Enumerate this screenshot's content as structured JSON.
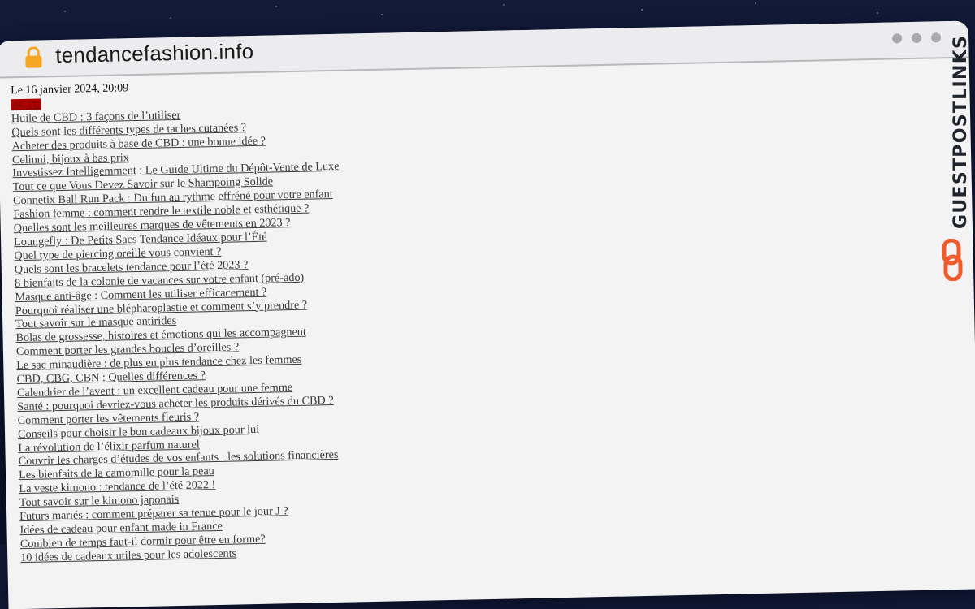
{
  "browser": {
    "url": "tendancefashion.info",
    "window_controls": [
      "dot",
      "dot",
      "dot"
    ]
  },
  "brand": {
    "name": "GUESTPOSTLINKS",
    "logo_icon": "chain-link-icon",
    "logo_color": "#ef5b2a"
  },
  "page": {
    "date": "Le 16 janvier 2024, 20:09",
    "category_badge": "ACTU",
    "badge_color": "#b00000",
    "articles": [
      "Huile de CBD : 3 façons de l’utiliser",
      "Quels sont les différents types de taches cutanées ?",
      "Acheter des produits à base de CBD : une bonne idée ?",
      "Celinni, bijoux à bas prix",
      "Investissez Intelligemment : Le Guide Ultime du Dépôt-Vente de Luxe",
      "Tout ce que Vous Devez Savoir sur le Shampoing Solide",
      "Connetix Ball Run Pack : Du fun au rythme effréné pour votre enfant",
      "Fashion femme : comment rendre le textile noble et esthétique ?",
      "Quelles sont les meilleures marques de vêtements en 2023 ?",
      "Loungefly : De Petits Sacs Tendance Idéaux pour l’Été",
      "Quel type de piercing oreille vous convient ?",
      "Quels sont les bracelets tendance pour l’été 2023 ?",
      "8 bienfaits de la colonie de vacances sur votre enfant (pré-ado)",
      "Masque anti-âge : Comment les utiliser efficacement ?",
      "Pourquoi réaliser une blépharoplastie et comment s’y prendre ?",
      "Tout savoir sur le masque antirides",
      "Bolas de grossesse, histoires et émotions qui les accompagnent",
      "Comment porter les grandes boucles d’oreilles ?",
      "Le sac minaudière : de plus en plus tendance chez les femmes",
      "CBD, CBG, CBN : Quelles différences ?",
      "Calendrier de l’avent : un excellent cadeau pour une femme",
      "Santé : pourquoi devriez-vous acheter les produits dérivés du CBD ?",
      "Comment porter les vêtements fleuris ?",
      "Conseils pour choisir le bon cadeaux bijoux pour lui",
      "La révolution de l’élixir parfum naturel",
      "Couvrir les charges d’études de vos enfants : les solutions financières",
      "Les bienfaits de la camomille pour la peau",
      "La veste kimono : tendance de l’été 2022 !",
      "Tout savoir sur le kimono japonais",
      "Futurs mariés : comment préparer sa tenue pour le jour J ?",
      "Idées de cadeau pour enfant made in France",
      "Combien de temps faut-il dormir pour être en forme?",
      "10 idées de cadeaux utiles pour les adolescents"
    ]
  }
}
